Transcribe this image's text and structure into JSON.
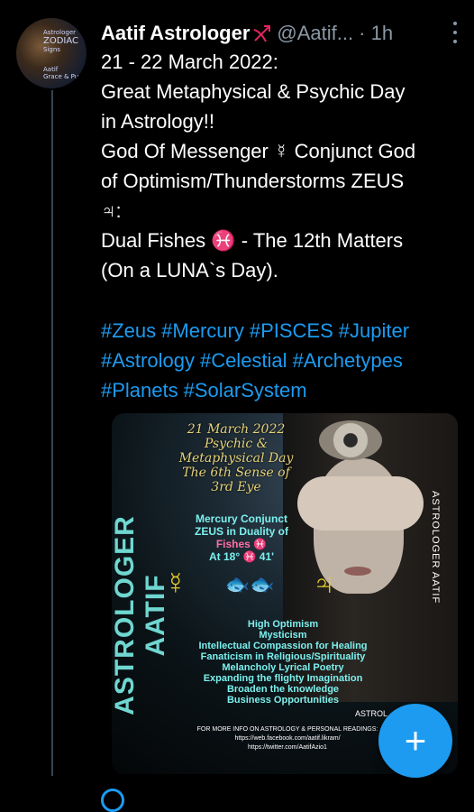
{
  "tweet": {
    "author_name": "Aatif Astrologer",
    "author_badge_icon": "bow-arrow-icon",
    "handle": "@Aatif...",
    "time": "1h",
    "body": "21 - 22 March 2022:\nGreat Metaphysical & Psychic Day\nin Astrology!!\nGod Of Messenger ☿ Conjunct God\nof Optimism/Thunderstorms ZEUS\n♃:\nDual Fishes ♓ - The 12th Matters\n(On a LUNA`s Day).",
    "hashtags": [
      "#Zeus",
      "#Mercury",
      "#PISCES",
      "#Jupiter",
      "#Astrology",
      "#Celestial",
      "#Archetypes",
      "#Planets",
      "#SolarSystem"
    ]
  },
  "avatar": {
    "lines": [
      "Astrologer",
      "ZODIAC",
      "Signs",
      "Aatif",
      "Grace & Pure"
    ]
  },
  "media": {
    "side_left": "ASTROLOGER AATIF",
    "side_right": "ASTROLOGER AATIF",
    "title_lines": [
      "21 March 2022",
      "Psychic &",
      "Metaphysical Day",
      "The 6th Sense of",
      "3rd Eye"
    ],
    "mercury_lines": [
      "Mercury Conjunct",
      "ZEUS in Duality of",
      "Fishes ♓",
      "At 18° ♓ 41'"
    ],
    "symbols": {
      "mercury": "☿",
      "fish": "🐟🐟",
      "jupiter": "♃"
    },
    "list": [
      "High Optimism",
      "Mysticism",
      "Intellectual Compassion for Healing",
      "Fanaticism in Religious/Spirituality",
      "Melancholy Lyrical Poetry",
      "Expanding the flighty Imagination",
      "Broaden the knowledge",
      "Business Opportunities"
    ],
    "info_lines": [
      "FOR MORE INFO ON ASTROLOGY & PERSONAL READINGS:",
      "https://web.facebook.com/aatif.likram/",
      "https://twitter.com/AatifAzio1"
    ],
    "astrol": "ASTROL"
  },
  "fab": {
    "label": "+"
  },
  "colors": {
    "accent": "#1d9bf0",
    "muted": "#8b98a5",
    "background": "#000000"
  }
}
